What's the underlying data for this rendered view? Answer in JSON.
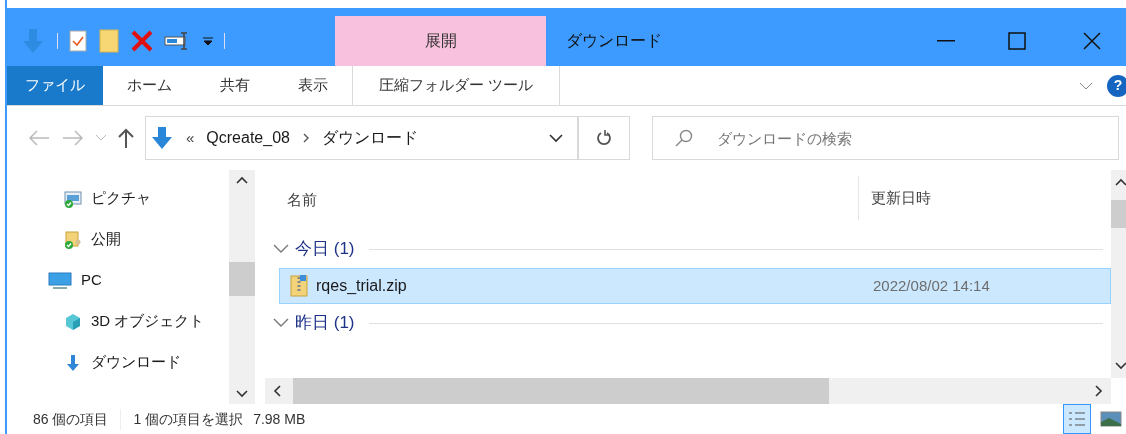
{
  "contextual_tab_group": {
    "label": "展開"
  },
  "window": {
    "title": "ダウンロード"
  },
  "help": {
    "label": "?"
  },
  "ribbon_tabs": [
    {
      "label": "ファイル",
      "kind": "file"
    },
    {
      "label": "ホーム",
      "kind": "tab"
    },
    {
      "label": "共有",
      "kind": "tab"
    },
    {
      "label": "表示",
      "kind": "tab"
    },
    {
      "label": "圧縮フォルダー ツール",
      "kind": "contextual"
    }
  ],
  "address_bar": {
    "overflow": "«",
    "path": [
      "Qcreate_08",
      "ダウンロード"
    ]
  },
  "search": {
    "placeholder": "ダウンロードの検索"
  },
  "sidebar": {
    "items": [
      {
        "children": [
          {
            "label": "ピクチャ",
            "kind": "pictures"
          },
          {
            "label": "公開",
            "kind": "public"
          }
        ]
      },
      {
        "label": "PC",
        "kind": "pc",
        "children": [
          {
            "label": "3D オブジェクト",
            "kind": "objects3d"
          },
          {
            "label": "ダウンロード",
            "kind": "downloads"
          }
        ]
      }
    ]
  },
  "file_list": {
    "columns": [
      "名前",
      "更新日時"
    ],
    "groups": [
      {
        "label": "今日 (1)",
        "expanded": true,
        "rows": [
          {
            "name": "rqes_trial.zip",
            "date": "2022/08/02 14:14",
            "selected": true
          }
        ]
      },
      {
        "label": "昨日 (1)",
        "expanded": true
      }
    ]
  },
  "status_bar": {
    "item_count": "86 個の項目",
    "selection": "1 個の項目を選択",
    "size": "7.98 MB"
  },
  "view_buttons": [
    {
      "kind": "details",
      "selected": true
    },
    {
      "kind": "large_icons",
      "selected": false
    }
  ]
}
